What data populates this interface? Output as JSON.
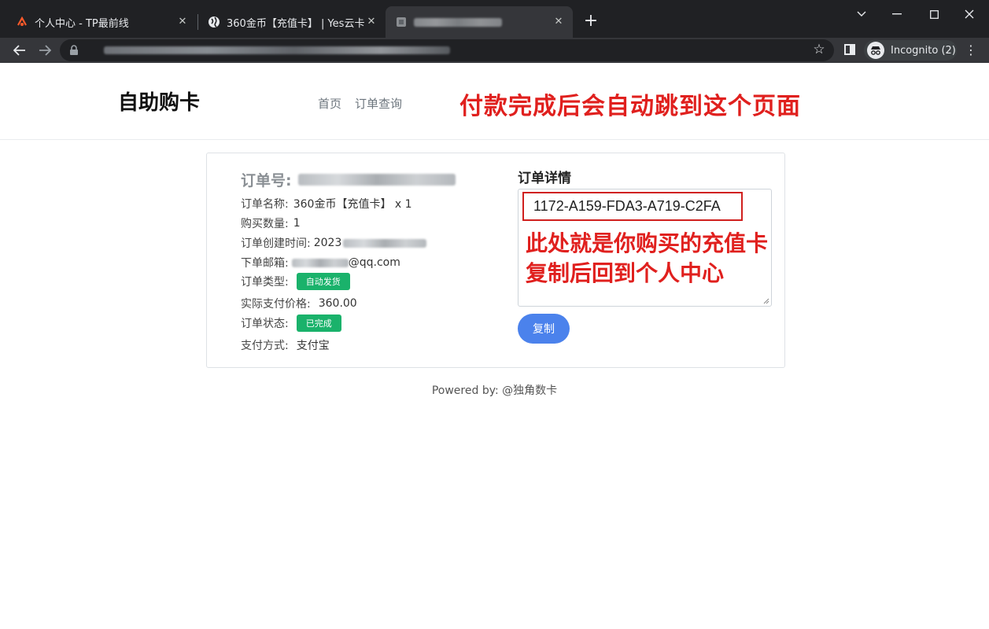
{
  "browser": {
    "tabs": [
      {
        "title": "个人中心 - TP最前线",
        "favicon": "tp-logo-icon"
      },
      {
        "title": "360金币【充值卡】 | Yes云卡",
        "favicon": "globe-icon"
      },
      {
        "title": "",
        "favicon": "page-icon"
      }
    ],
    "incognito_label": "Incognito (2)"
  },
  "header": {
    "brand": "自助购卡",
    "nav": [
      "首页",
      "订单查询"
    ],
    "annotation": "付款完成后会自动跳到这个页面"
  },
  "order": {
    "order_no_label": "订单号:",
    "fields": {
      "name_label": "订单名称:",
      "name_value": "360金币【充值卡】 x 1",
      "qty_label": "购买数量:",
      "qty_value": "1",
      "created_label": "订单创建时间:",
      "created_value": "2023",
      "email_label": "下单邮箱:",
      "email_value": "@qq.com",
      "type_label": "订单类型:",
      "type_badge": "自动发货",
      "price_label": "实际支付价格:",
      "price_value": "360.00",
      "status_label": "订单状态:",
      "status_badge": "已完成",
      "pay_label": "支付方式:",
      "pay_value": "支付宝"
    }
  },
  "detail": {
    "title": "订单详情",
    "card_code": "1172-A159-FDA3-A719-C2FA",
    "annotation_line1": "此处就是你购买的充值卡",
    "annotation_line2": "复制后回到个人中心",
    "copy_label": "复制"
  },
  "footer": "Powered by: @独角数卡",
  "colors": {
    "accent_blue": "#4b82ec",
    "badge_green": "#1ab26b",
    "annotation_red": "#e0201e"
  }
}
